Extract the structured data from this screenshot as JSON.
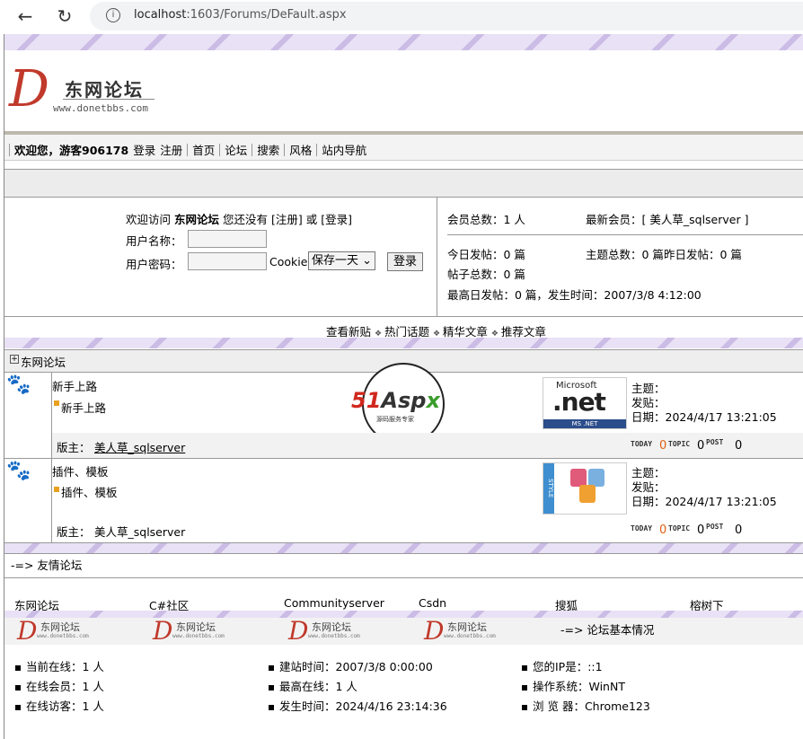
{
  "browser": {
    "url_host": "localhost",
    "url_rest": ":1603/Forums/DeFault.aspx"
  },
  "header": {
    "site_name": "东网论坛",
    "site_url": "www.donetbbs.com"
  },
  "nav": {
    "welcome": "欢迎您，游客906178",
    "login": "登录",
    "register": "注册",
    "items": [
      "首页",
      "论坛",
      "搜索",
      "风格",
      "站内导航"
    ]
  },
  "login": {
    "intro_pre": "欢迎访问",
    "intro_site": "东网论坛",
    "intro_mid": "您还没有",
    "register_link": "[注册]",
    "or": "或",
    "login_link": "[登录]",
    "username_label": "用户名称：",
    "password_label": "用户密码：",
    "cookie_label": "Cookie",
    "cookie_selected": "保存一天",
    "submit": "登录"
  },
  "stats": {
    "members": "会员总数：1 人",
    "newest_label": "最新会员：[",
    "newest_name": "美人草_sqlserver",
    "newest_end": "]",
    "today_posts": "今日发帖：0 篇",
    "topics": "主题总数：0 篇",
    "yesterday": "昨日发帖：0 篇",
    "posts_total": "帖子总数：0 篇",
    "peak": "最高日发帖：0 篇，发生时间：2007/3/8 4:12:00"
  },
  "links": [
    "查看新贴",
    "热门话题",
    "精华文章",
    "推荐文章"
  ],
  "category": "东网论坛",
  "forums": [
    {
      "name": "新手上路",
      "sub": "新手上路",
      "moderator_label": "版主：",
      "moderator": "美人草_sqlserver",
      "topic": "主题：",
      "post": "发贴：",
      "date": "日期：2024/4/17 13:21:05",
      "today": "0",
      "topic_count": "0",
      "post_count": "0",
      "icon": "dotnet-logo-icon"
    },
    {
      "name": "插件、模板",
      "sub": "插件、模板",
      "moderator_label": "版主：",
      "moderator": "美人草_sqlserver",
      "topic": "主题：",
      "post": "发贴：",
      "date": "日期：2024/4/17 13:21:05",
      "today": "0",
      "topic_count": "0",
      "post_count": "0",
      "icon": "paint-cans-icon"
    }
  ],
  "ad": {
    "brand": "51Aspx",
    "tagline": "源码服务专家"
  },
  "mini_labels": {
    "today": "TODAY",
    "topic": "TOPIC",
    "post": "POST"
  },
  "friendly": {
    "title": "-=> 友情论坛",
    "links": [
      "东网论坛",
      "C#社区",
      "Communityserver",
      "Csdn",
      "搜狐",
      "榕树下"
    ],
    "tile_name": "东网论坛",
    "tile_url": "www.donetbbs.com"
  },
  "basic_info": {
    "title": "-=> 论坛基本情况",
    "items": [
      "当前在线：1 人",
      "建站时间：2007/3/8 0:00:00",
      "您的IP是：::1",
      "在线会员：1 人",
      "最高在线：1 人",
      "操作系统：WinNT",
      "在线访客：1 人",
      "发生时间：2024/4/16 23:14:36",
      "浏 览 器：Chrome123"
    ]
  }
}
